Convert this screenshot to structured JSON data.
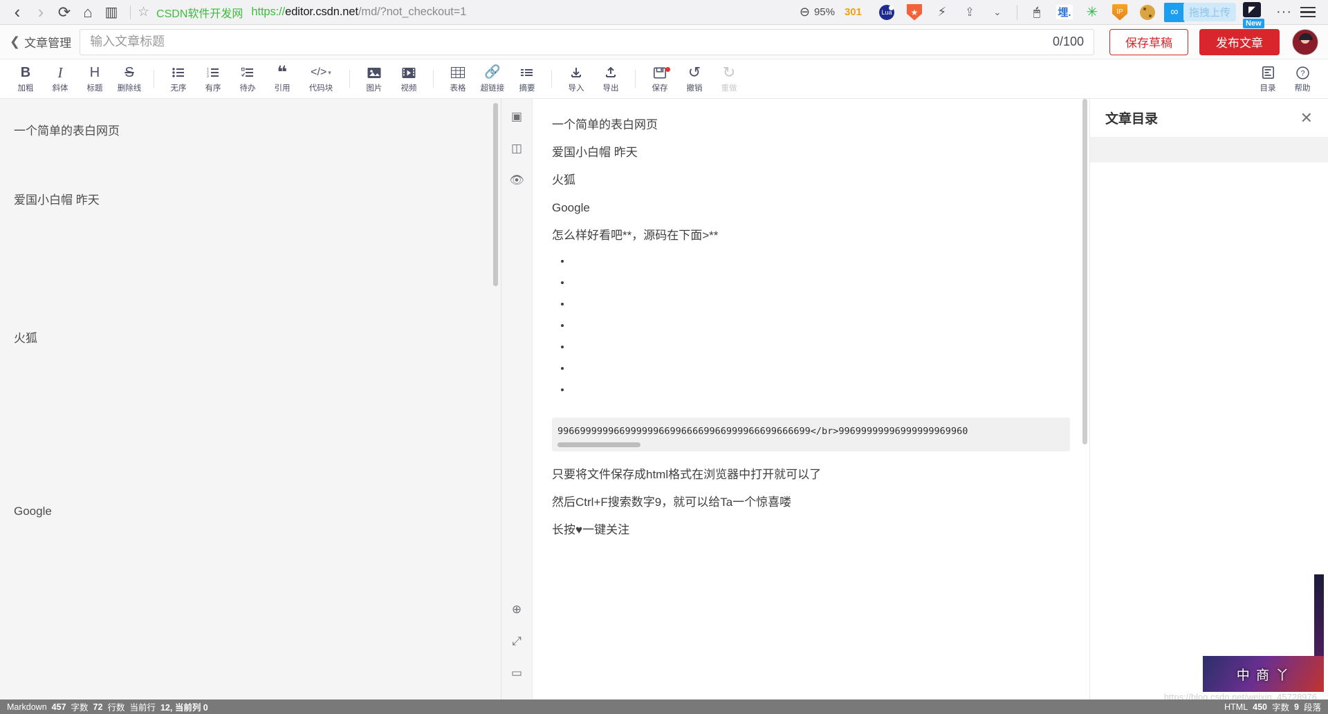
{
  "browser": {
    "nav": {
      "back": "‹",
      "forward": "›",
      "reload": "⟳",
      "home": "⌂",
      "reader": "▥"
    },
    "bookmark_star": "☆",
    "site_name": "CSDN软件开发网",
    "url": {
      "scheme": "https://",
      "host": "editor.csdn.net",
      "path": "/md/?not_checkout=1"
    },
    "zoom": "95%",
    "counter": "301",
    "extensions": [
      {
        "name": "lua-extension-icon",
        "label": "Lua"
      },
      {
        "name": "shield-extension-icon",
        "label": "★"
      },
      {
        "name": "bolt-extension-icon",
        "label": "⚡"
      },
      {
        "name": "share-icon",
        "label": "⇪"
      },
      {
        "name": "chevron-down-icon",
        "label": "⌄"
      },
      {
        "name": "mouse-extension-icon",
        "label": "🖱"
      },
      {
        "name": "mai-extension-icon",
        "label": "埋."
      },
      {
        "name": "gear-extension-icon",
        "label": "✳"
      },
      {
        "name": "ip-shield-icon",
        "label": "IP"
      },
      {
        "name": "cookie-extension-icon",
        "label": ""
      }
    ],
    "upload_tip": "拖拽上传",
    "new_badge": "New",
    "menu_dots": "···"
  },
  "header": {
    "back_label": "文章管理",
    "back_chevron": "❮",
    "title_placeholder": "输入文章标题",
    "title_value": "",
    "counter": "0/100",
    "save_draft": "保存草稿",
    "publish": "发布文章"
  },
  "toolbar": {
    "groups": [
      {
        "items": [
          {
            "icon": "B",
            "label": "加粗",
            "name": "bold"
          },
          {
            "icon": "I",
            "label": "斜体",
            "name": "italic"
          },
          {
            "icon": "H",
            "label": "标题",
            "name": "heading"
          },
          {
            "icon": "S",
            "label": "删除线",
            "name": "strikethrough"
          }
        ]
      },
      {
        "items": [
          {
            "icon": "☰",
            "label": "无序",
            "name": "unordered-list"
          },
          {
            "icon": "☰",
            "label": "有序",
            "name": "ordered-list"
          },
          {
            "icon": "☰",
            "label": "待办",
            "name": "todo-list"
          },
          {
            "icon": "❝",
            "label": "引用",
            "name": "blockquote"
          },
          {
            "icon": "</>",
            "label": "代码块",
            "name": "code-block",
            "caret": true
          }
        ]
      },
      {
        "items": [
          {
            "icon": "🖼",
            "label": "图片",
            "name": "image"
          },
          {
            "icon": "🎬",
            "label": "视频",
            "name": "video"
          }
        ]
      },
      {
        "items": [
          {
            "icon": "▦",
            "label": "表格",
            "name": "table"
          },
          {
            "icon": "🔗",
            "label": "超链接",
            "name": "hyperlink"
          },
          {
            "icon": "≡",
            "label": "摘要",
            "name": "summary"
          }
        ]
      },
      {
        "items": [
          {
            "icon": "⤓",
            "label": "导入",
            "name": "import"
          },
          {
            "icon": "⤒",
            "label": "导出",
            "name": "export"
          }
        ]
      },
      {
        "items": [
          {
            "icon": "💾",
            "label": "保存",
            "name": "save",
            "dot": true
          },
          {
            "icon": "↺",
            "label": "撤销",
            "name": "undo"
          },
          {
            "icon": "↻",
            "label": "重做",
            "name": "redo",
            "disabled": true
          }
        ]
      }
    ],
    "right": [
      {
        "icon": "▤",
        "label": "目录",
        "name": "outline"
      },
      {
        "icon": "?",
        "label": "帮助",
        "name": "help"
      }
    ]
  },
  "editor": {
    "content": "一个简单的表白网页\n\n爱国小白帽 昨天\n\n\n\n火狐\n\n\n\n\nGoogle"
  },
  "rail": {
    "icons": [
      {
        "name": "single-pane-icon",
        "glyph": "▣"
      },
      {
        "name": "split-pane-icon",
        "glyph": "◫"
      },
      {
        "name": "preview-eye-icon",
        "glyph": "👁"
      }
    ],
    "bottom_icons": [
      {
        "name": "sync-scroll-icon",
        "glyph": "⊕"
      },
      {
        "name": "fullscreen-icon",
        "glyph": "⤢"
      },
      {
        "name": "fullwidth-icon",
        "glyph": "▭"
      }
    ]
  },
  "preview": {
    "lines": [
      "一个简单的表白网页",
      "爱国小白帽 昨天",
      "火狐",
      "Google",
      "怎么样好看吧**，源码在下面>**"
    ],
    "bullet_count": 7,
    "code": "996699999966999999669966669966999966699666699</br>99699999996999999969960",
    "tail_lines": [
      "只要将文件保存成html格式在浏览器中打开就可以了",
      "然后Ctrl+F搜索数字9，就可以给Ta一个惊喜喽",
      "长按♥一键关注"
    ]
  },
  "toc": {
    "title": "文章目录",
    "close": "✕"
  },
  "ad": {
    "text": "中 商 丫"
  },
  "status": {
    "left": [
      {
        "text": "Markdown",
        "bold": false
      },
      {
        "text": "457",
        "bold": true
      },
      {
        "text": "字数",
        "bold": false
      },
      {
        "text": "72",
        "bold": true
      },
      {
        "text": "行数",
        "bold": false
      },
      {
        "text": "当前行",
        "bold": false
      },
      {
        "text": "12, 当前列 0",
        "bold": true
      }
    ],
    "right": [
      {
        "text": "HTML",
        "bold": false
      },
      {
        "text": "450",
        "bold": true
      },
      {
        "text": "字数",
        "bold": false
      },
      {
        "text": "9",
        "bold": true
      },
      {
        "text": "段落",
        "bold": false
      }
    ],
    "watermark": "https://blog.csdn.net/weixin_45728976"
  },
  "colors": {
    "accent_red": "#d9262c",
    "link_green": "#3dbc3d",
    "statusbar": "#797979"
  }
}
